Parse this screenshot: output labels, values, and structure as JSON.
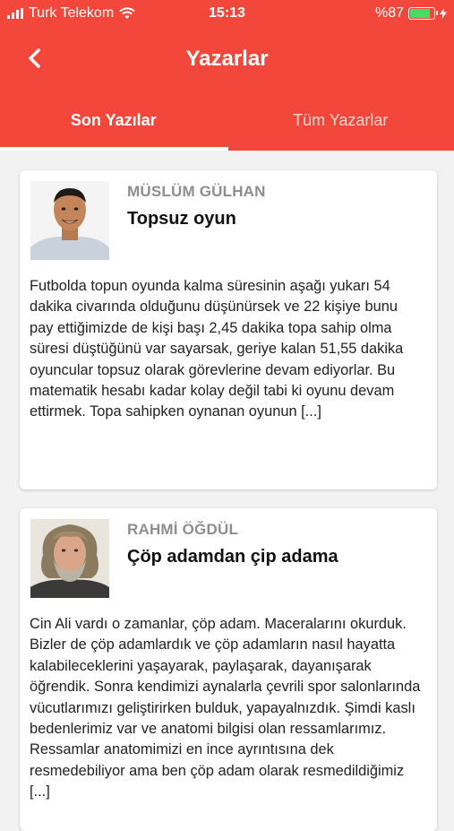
{
  "status_bar": {
    "carrier": "Turk Telekom",
    "time": "15:13",
    "battery_text": "%87",
    "battery_level": 0.87,
    "battery_color": "#4cd964"
  },
  "header": {
    "back_icon": "chevron-left-icon",
    "title": "Yazarlar",
    "accent_color": "#f2473a"
  },
  "tabs": [
    {
      "label": "Son Yazılar",
      "active": true
    },
    {
      "label": "Tüm Yazarlar",
      "active": false
    }
  ],
  "articles": [
    {
      "author": "MÜSLÜM GÜLHAN",
      "title": "Topsuz oyun",
      "excerpt": "Futbolda topun oyunda kalma süresinin aşağı yukarı 54 dakika civarında olduğunu düşünürsek ve 22 kişiye bunu pay ettiğimizde de kişi başı 2,45 dakika topa sahip olma süresi düştüğünü var sayarsak, geriye kalan 51,55 dakika oyuncular topsuz olarak görevlerine devam ediyorlar. Bu matematik hesabı kadar kolay değil tabi ki oyunu devam ettirmek. Topa sahipken oynanan oyunun [...]"
    },
    {
      "author": "RAHMİ ÖĞDÜL",
      "title": "Çöp adamdan çip adama",
      "excerpt": "Cin Ali vardı o zamanlar, çöp adam. Maceralarını okurduk. Bizler de çöp adamlardık ve çöp adamların nasıl hayatta kalabileceklerini yaşayarak, paylaşarak, dayanışarak öğrendik. Sonra kendimizi aynalarla çevrili spor salonlarında vücutlarımızı geliştirirken bulduk, yapayalnızdık. Şimdi kaslı bedenlerimiz var ve anatomi bilgisi olan ressamlarımız. Ressamlar anatomimizi en ince ayrıntısına dek resmedebiliyor ama ben çöp adam olarak resmedildiğimiz [...]"
    }
  ]
}
